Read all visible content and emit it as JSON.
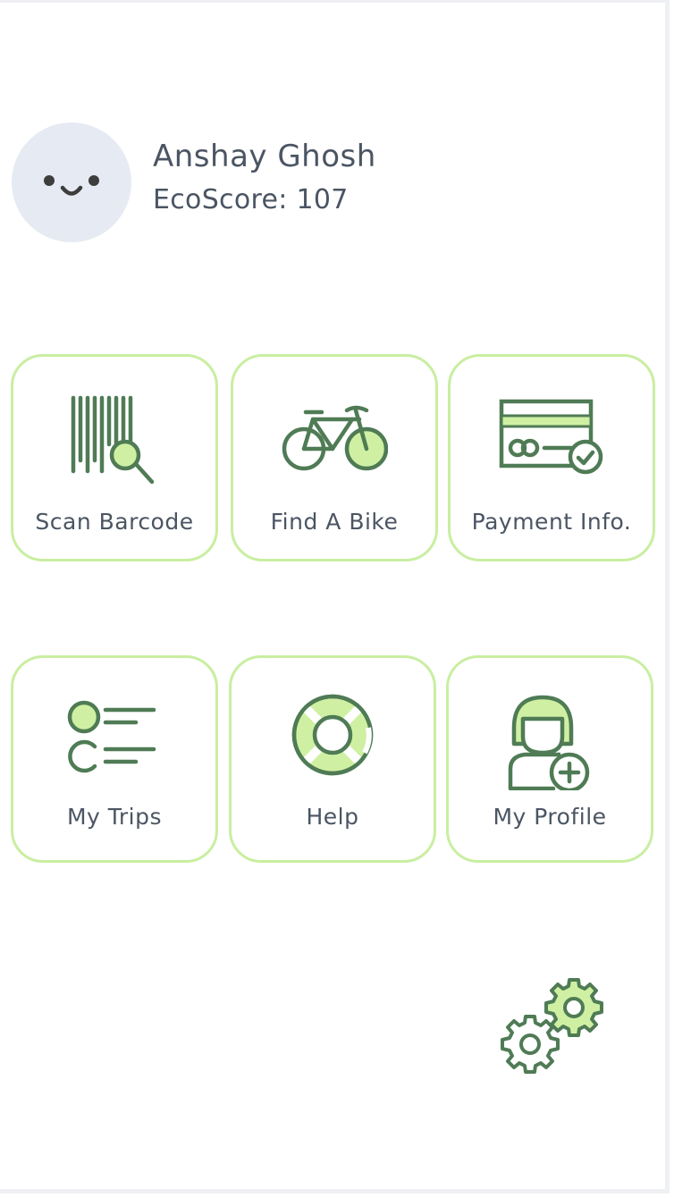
{
  "profile": {
    "name": "Anshay Ghosh",
    "eco_score": "EcoScore: 107"
  },
  "tiles": [
    {
      "label": "Scan Barcode",
      "icon": "barcode-scan-icon"
    },
    {
      "label": "Find A Bike",
      "icon": "bicycle-icon"
    },
    {
      "label": "Payment Info.",
      "icon": "credit-card-icon"
    },
    {
      "label": "My Trips",
      "icon": "trips-list-icon"
    },
    {
      "label": "Help",
      "icon": "lifebuoy-icon"
    },
    {
      "label": "My Profile",
      "icon": "add-user-icon"
    }
  ],
  "settings": {
    "icon": "settings-gears-icon"
  },
  "colors": {
    "icon_stroke": "#4f7b55",
    "icon_fill": "#cff0a2",
    "tile_border": "#c9eea1",
    "text": "#4b5563",
    "avatar_bg": "#e6eaf2"
  }
}
